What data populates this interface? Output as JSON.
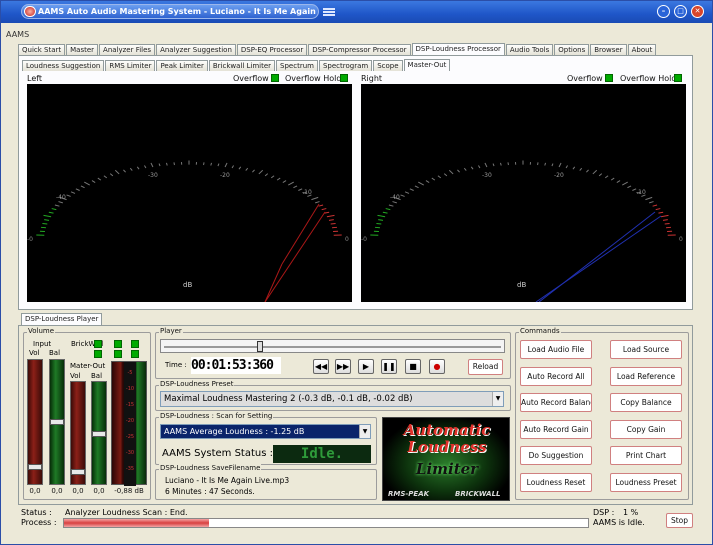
{
  "window": {
    "title": "AAMS Auto Audio Mastering System - Luciano - It Is Me Again Live.mp3"
  },
  "app_label": "AAMS",
  "main_tabs": [
    "Quick Start",
    "Master",
    "Analyzer Files",
    "Analyzer Suggestion",
    "DSP-EQ Processor",
    "DSP-Compressor Processor",
    "DSP-Loudness Processor",
    "Audio Tools",
    "Options",
    "Browser",
    "About"
  ],
  "sub_tabs": [
    "Loudness Suggestion",
    "RMS Limiter",
    "Peak Limiter",
    "Brickwall Limiter",
    "Spectrum",
    "Spectrogram",
    "Scope",
    "Master-Out"
  ],
  "meters": {
    "left": {
      "label": "Left",
      "overflow": "Overflow",
      "overflow_hold": "Overflow Hold",
      "unit": "dB"
    },
    "right": {
      "label": "Right",
      "overflow": "Overflow",
      "overflow_hold": "Overflow Hold",
      "unit": "dB"
    },
    "scale": [
      "-40",
      "-30",
      "-20",
      "-10",
      "0"
    ],
    "edge": "-0"
  },
  "player_tab": "DSP-Loudness Player",
  "volume": {
    "group": "Volume",
    "input": "Input",
    "vol": "Vol",
    "bal": "Bal",
    "brickwall": "BrickWall",
    "master_out": "Mater-Out",
    "vol2": "Vol",
    "bal2": "Bal",
    "values": [
      "0,0",
      "0,0",
      "0,0",
      "0,0",
      "-0,88 dB"
    ],
    "scale": [
      "-5",
      "-10",
      "-15",
      "-20",
      "-25",
      "-30",
      "-35"
    ]
  },
  "player": {
    "group": "Player",
    "time_label": "Time :",
    "time": "00:01:53:360",
    "reload": "Reload"
  },
  "preset": {
    "group": "DSP-Loudness Preset",
    "value": "Maximal Loudness Mastering  2  (-0.3 dB, -0.1 dB, -0.02 dB)"
  },
  "scan": {
    "group": "DSP-Loudness : Scan for Setting",
    "value": "AAMS Average Loudness : -1.25 dB",
    "status_label": "AAMS System Status :",
    "status": "Idle."
  },
  "savefile": {
    "group": "DSP-Loudness SaveFilename",
    "line1": "Luciano - It Is Me Again Live.mp3",
    "line2": "6 Minutes : 47 Seconds."
  },
  "logo": {
    "line1": "Automatic",
    "line2": "Loudness",
    "line3": "Limiter",
    "bottom_left": "RMS-PEAK",
    "bottom_right": "BRICKWALL"
  },
  "commands": {
    "group": "Commands",
    "buttons": [
      "Load Audio File",
      "Load Source",
      "Auto Record All",
      "Load Reference",
      "Auto Record Balance",
      "Copy Balance",
      "Auto Record Gain",
      "Copy Gain",
      "Do Suggestion",
      "Print Chart",
      "Loudness Reset",
      "Loudness Preset"
    ]
  },
  "statusbar": {
    "status_label": "Status :",
    "status": "Analyzer Loudness Scan : End.",
    "process_label": "Process :",
    "dsp_label": "DSP :",
    "dsp": "1 %",
    "aams": "AAMS is Idle.",
    "stop": "Stop"
  },
  "colors": {
    "left_needle": "#c02020",
    "right_needle": "#2030b0",
    "accent": "#d08080"
  }
}
